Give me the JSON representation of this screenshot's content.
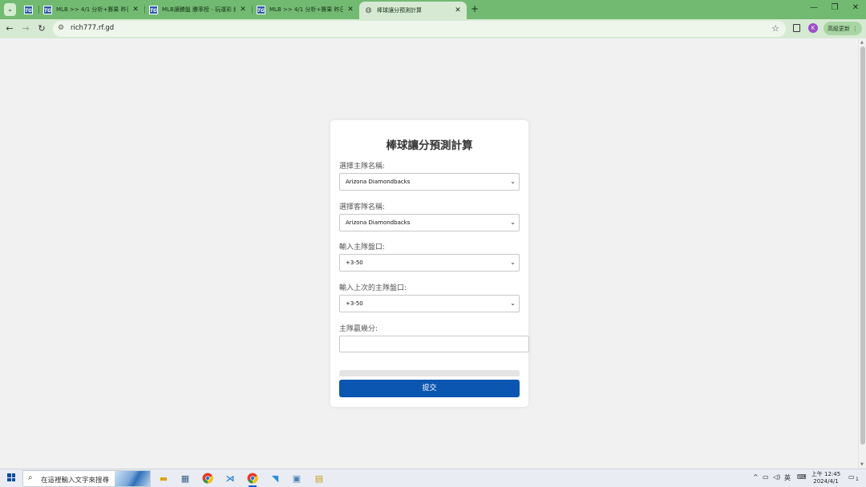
{
  "browser": {
    "tabs": [
      {
        "title": "MLB >> 4/1 分析+賽果 昨日全",
        "favicon": "TG",
        "active": false
      },
      {
        "title": "MLB讓勝盤 勝率榜 - 玩運彩 給",
        "favicon": "TG",
        "active": false
      },
      {
        "title": "MLB >> 4/1 分析+賽果 昨日全",
        "favicon": "TG",
        "active": false
      },
      {
        "title": "棒球讓分預測計算",
        "favicon": "globe-icon",
        "active": true
      }
    ],
    "url": "rich777.rf.gd",
    "profile_initial": "K",
    "update_label": "高級更新"
  },
  "form": {
    "title": "棒球讓分預測計算",
    "home_team_label": "選擇主隊名稱:",
    "home_team_value": "Arizona Diamondbacks",
    "away_team_label": "選擇客隊名稱:",
    "away_team_value": "Arizona Diamondbacks",
    "home_line_label": "輸入主隊盤口:",
    "home_line_value": "+3-50",
    "prev_home_line_label": "輸入上次的主隊盤口:",
    "prev_home_line_value": "+3-50",
    "home_margin_label": "主隊贏幾分:",
    "home_margin_value": "",
    "submit_label": "提交"
  },
  "taskbar": {
    "search_placeholder": "在這裡輸入文字來搜尋",
    "ime": "英",
    "time": "上午 12:45",
    "date": "2024/4/1",
    "notification_count": "1"
  },
  "colors": {
    "tabstrip": "#72ba72",
    "toolbar": "#d6ead3",
    "submit": "#0b56b0"
  }
}
